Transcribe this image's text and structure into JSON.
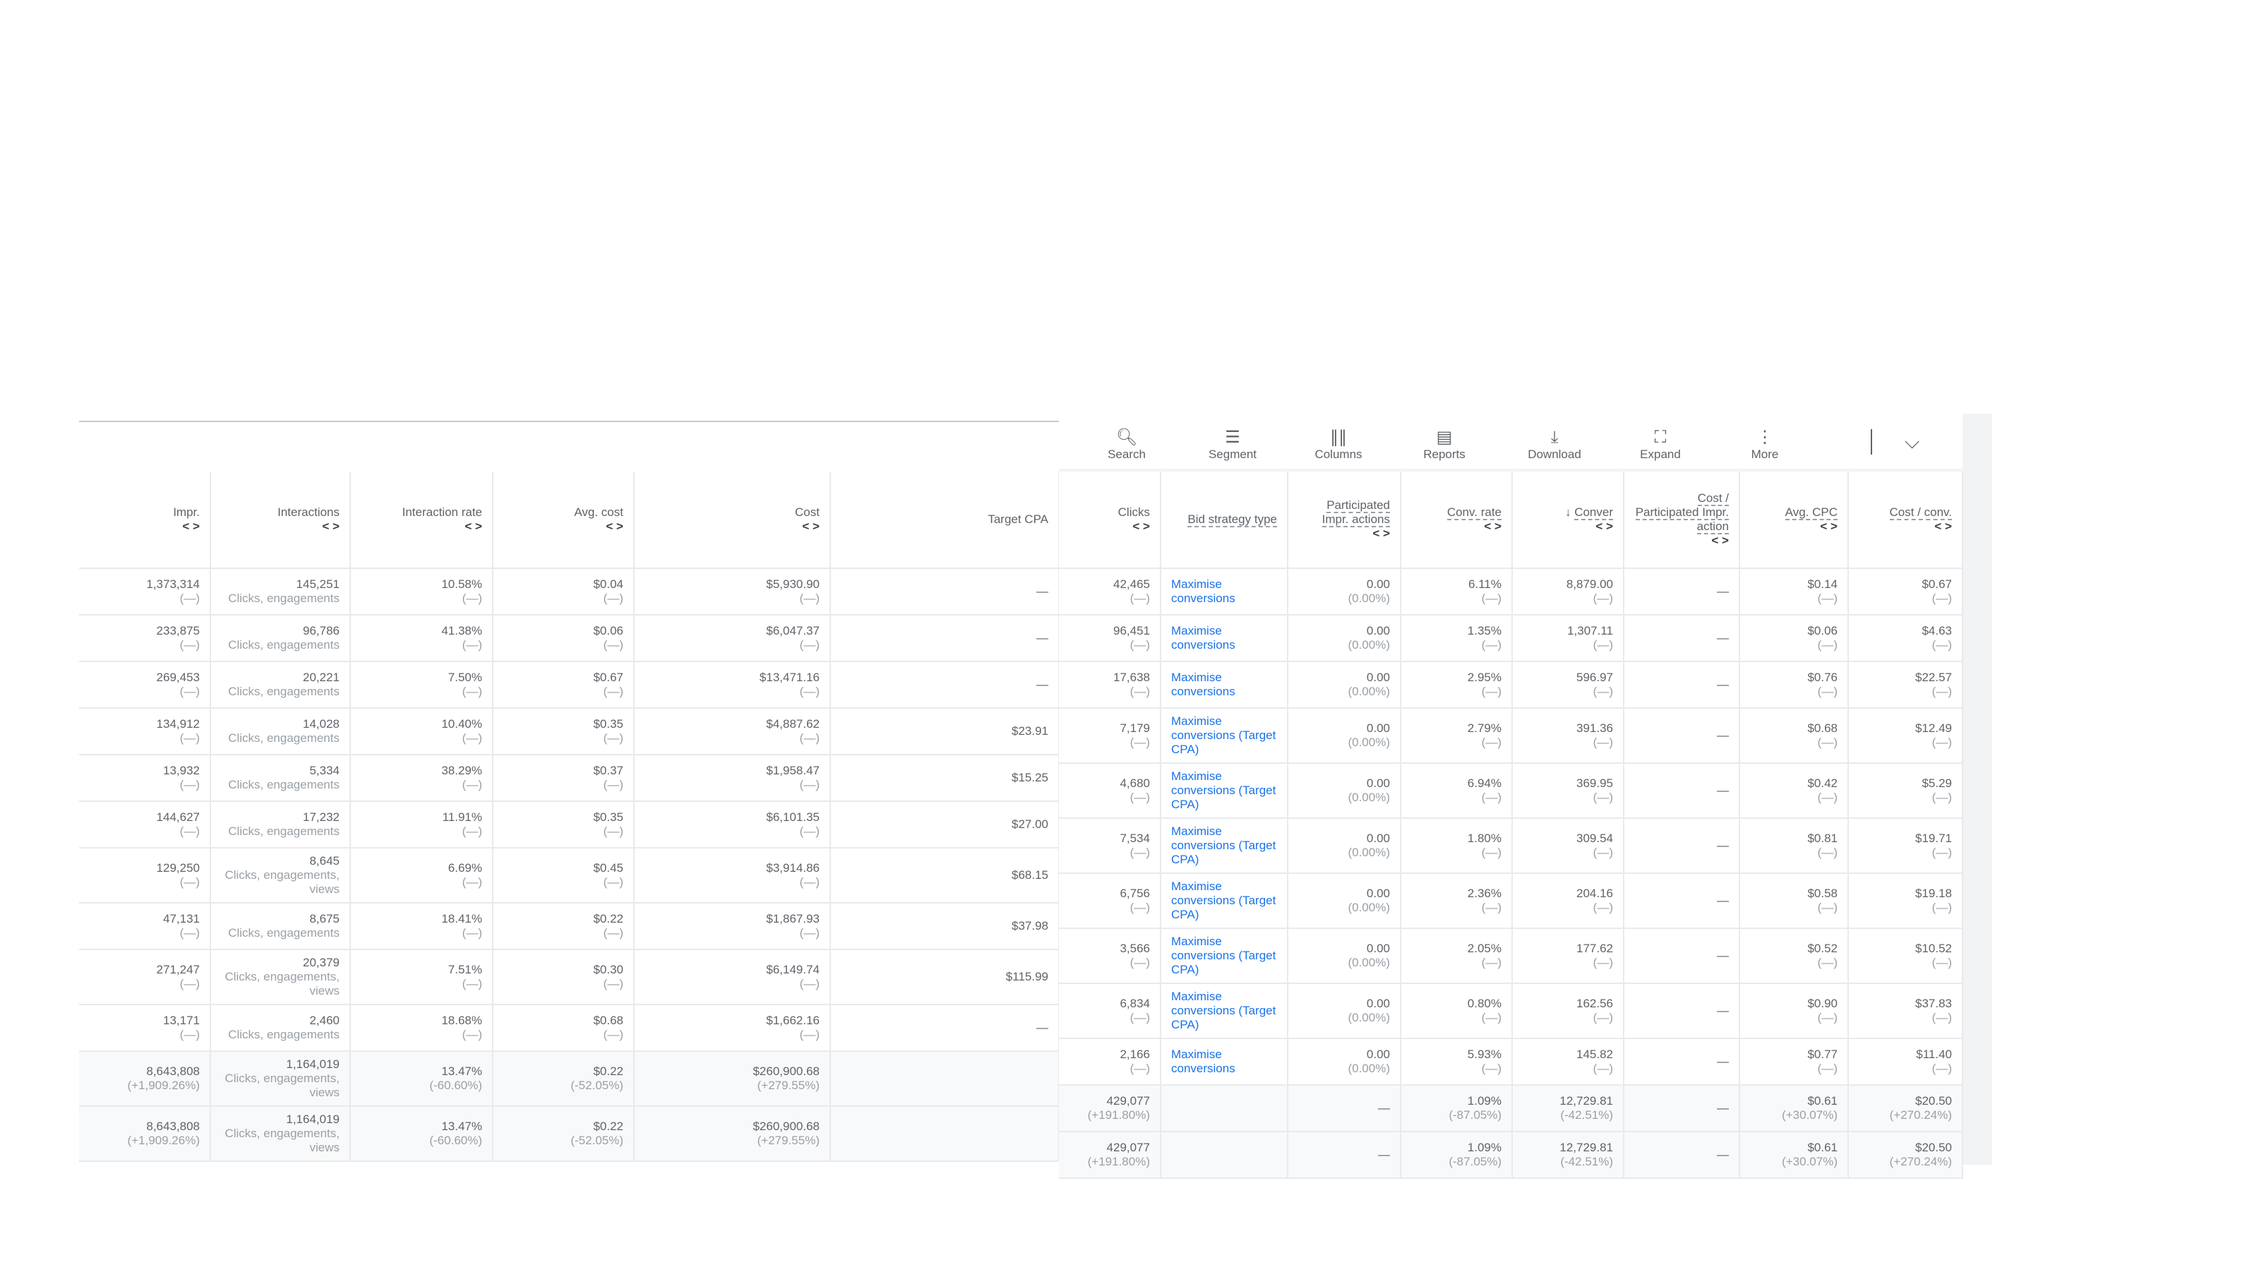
{
  "left_table": {
    "headers": [
      {
        "label": "Impr.",
        "arrows": "< >"
      },
      {
        "label": "Interactions",
        "arrows": "< >"
      },
      {
        "label": "Interaction rate",
        "arrows": "< >"
      },
      {
        "label": "Avg. cost",
        "arrows": "< >"
      },
      {
        "label": "Cost",
        "arrows": "< >"
      },
      {
        "label": "Target CPA",
        "arrows": ""
      }
    ],
    "rows": [
      {
        "impr": "1,373,314",
        "impr_sub": "(—)",
        "int": "145,251",
        "int_sub": "Clicks, engagements",
        "rate": "10.58%",
        "rate_sub": "(—)",
        "avg": "$0.04",
        "avg_sub": "(—)",
        "cost": "$5,930.90",
        "cost_sub": "(—)",
        "cpa": "—"
      },
      {
        "impr": "233,875",
        "impr_sub": "(—)",
        "int": "96,786",
        "int_sub": "Clicks, engagements",
        "rate": "41.38%",
        "rate_sub": "(—)",
        "avg": "$0.06",
        "avg_sub": "(—)",
        "cost": "$6,047.37",
        "cost_sub": "(—)",
        "cpa": "—"
      },
      {
        "impr": "269,453",
        "impr_sub": "(—)",
        "int": "20,221",
        "int_sub": "Clicks, engagements",
        "rate": "7.50%",
        "rate_sub": "(—)",
        "avg": "$0.67",
        "avg_sub": "(—)",
        "cost": "$13,471.16",
        "cost_sub": "(—)",
        "cpa": "—"
      },
      {
        "impr": "134,912",
        "impr_sub": "(—)",
        "int": "14,028",
        "int_sub": "Clicks, engagements",
        "rate": "10.40%",
        "rate_sub": "(—)",
        "avg": "$0.35",
        "avg_sub": "(—)",
        "cost": "$4,887.62",
        "cost_sub": "(—)",
        "cpa": "$23.91"
      },
      {
        "impr": "13,932",
        "impr_sub": "(—)",
        "int": "5,334",
        "int_sub": "Clicks, engagements",
        "rate": "38.29%",
        "rate_sub": "(—)",
        "avg": "$0.37",
        "avg_sub": "(—)",
        "cost": "$1,958.47",
        "cost_sub": "(—)",
        "cpa": "$15.25"
      },
      {
        "impr": "144,627",
        "impr_sub": "(—)",
        "int": "17,232",
        "int_sub": "Clicks, engagements",
        "rate": "11.91%",
        "rate_sub": "(—)",
        "avg": "$0.35",
        "avg_sub": "(—)",
        "cost": "$6,101.35",
        "cost_sub": "(—)",
        "cpa": "$27.00"
      },
      {
        "impr": "129,250",
        "impr_sub": "(—)",
        "int": "8,645",
        "int_sub": "Clicks, engagements, views",
        "rate": "6.69%",
        "rate_sub": "(—)",
        "avg": "$0.45",
        "avg_sub": "(—)",
        "cost": "$3,914.86",
        "cost_sub": "(—)",
        "cpa": "$68.15"
      },
      {
        "impr": "47,131",
        "impr_sub": "(—)",
        "int": "8,675",
        "int_sub": "Clicks, engagements",
        "rate": "18.41%",
        "rate_sub": "(—)",
        "avg": "$0.22",
        "avg_sub": "(—)",
        "cost": "$1,867.93",
        "cost_sub": "(—)",
        "cpa": "$37.98"
      },
      {
        "impr": "271,247",
        "impr_sub": "(—)",
        "int": "20,379",
        "int_sub": "Clicks, engagements, views",
        "rate": "7.51%",
        "rate_sub": "(—)",
        "avg": "$0.30",
        "avg_sub": "(—)",
        "cost": "$6,149.74",
        "cost_sub": "(—)",
        "cpa": "$115.99"
      },
      {
        "impr": "13,171",
        "impr_sub": "(—)",
        "int": "2,460",
        "int_sub": "Clicks, engagements",
        "rate": "18.68%",
        "rate_sub": "(—)",
        "avg": "$0.68",
        "avg_sub": "(—)",
        "cost": "$1,662.16",
        "cost_sub": "(—)",
        "cpa": "—"
      }
    ],
    "totals": [
      {
        "impr": "8,643,808",
        "impr_sub": "(+1,909.26%)",
        "int": "1,164,019",
        "int_sub": "Clicks, engagements, views",
        "rate": "13.47%",
        "rate_sub": "(-60.60%)",
        "avg": "$0.22",
        "avg_sub": "(-52.05%)",
        "cost": "$260,900.68",
        "cost_sub": "(+279.55%)",
        "cpa": ""
      },
      {
        "impr": "8,643,808",
        "impr_sub": "(+1,909.26%)",
        "int": "1,164,019",
        "int_sub": "Clicks, engagements, views",
        "rate": "13.47%",
        "rate_sub": "(-60.60%)",
        "avg": "$0.22",
        "avg_sub": "(-52.05%)",
        "cost": "$260,900.68",
        "cost_sub": "(+279.55%)",
        "cpa": ""
      }
    ]
  },
  "toolbar": {
    "search": "Search",
    "segment": "Segment",
    "columns": "Columns",
    "reports": "Reports",
    "download": "Download",
    "expand": "Expand",
    "more": "More"
  },
  "right_table": {
    "headers": [
      {
        "label": "Clicks",
        "arrows": "< >"
      },
      {
        "label": "Bid strategy type",
        "arrows": ""
      },
      {
        "label": "Participated Impr. actions",
        "arrows": "< >"
      },
      {
        "label": "Conv. rate",
        "arrows": "< >"
      },
      {
        "label": "Conver",
        "arrows": "< >",
        "sort": "↓"
      },
      {
        "label": "Cost / Participated Impr. action",
        "arrows": "< >"
      },
      {
        "label": "Avg. CPC",
        "arrows": "< >"
      },
      {
        "label": "Cost / conv.",
        "arrows": "< >"
      }
    ],
    "rows": [
      {
        "clicks": "42,465",
        "clicks_sub": "(—)",
        "bid": "Maximise conversions",
        "part": "0.00",
        "part_sub": "(0.00%)",
        "rate": "6.11%",
        "rate_sub": "(—)",
        "conv": "8,879.00",
        "conv_sub": "(—)",
        "cpp": "—",
        "cpc": "$0.14",
        "cpc_sub": "(—)",
        "cpconv": "$0.67",
        "cpconv_sub": "(—)"
      },
      {
        "clicks": "96,451",
        "clicks_sub": "(—)",
        "bid": "Maximise conversions",
        "part": "0.00",
        "part_sub": "(0.00%)",
        "rate": "1.35%",
        "rate_sub": "(—)",
        "conv": "1,307.11",
        "conv_sub": "(—)",
        "cpp": "—",
        "cpc": "$0.06",
        "cpc_sub": "(—)",
        "cpconv": "$4.63",
        "cpconv_sub": "(—)"
      },
      {
        "clicks": "17,638",
        "clicks_sub": "(—)",
        "bid": "Maximise conversions",
        "part": "0.00",
        "part_sub": "(0.00%)",
        "rate": "2.95%",
        "rate_sub": "(—)",
        "conv": "596.97",
        "conv_sub": "(—)",
        "cpp": "—",
        "cpc": "$0.76",
        "cpc_sub": "(—)",
        "cpconv": "$22.57",
        "cpconv_sub": "(—)"
      },
      {
        "clicks": "7,179",
        "clicks_sub": "(—)",
        "bid": "Maximise conversions (Target CPA)",
        "part": "0.00",
        "part_sub": "(0.00%)",
        "rate": "2.79%",
        "rate_sub": "(—)",
        "conv": "391.36",
        "conv_sub": "(—)",
        "cpp": "—",
        "cpc": "$0.68",
        "cpc_sub": "(—)",
        "cpconv": "$12.49",
        "cpconv_sub": "(—)"
      },
      {
        "clicks": "4,680",
        "clicks_sub": "(—)",
        "bid": "Maximise conversions (Target CPA)",
        "part": "0.00",
        "part_sub": "(0.00%)",
        "rate": "6.94%",
        "rate_sub": "(—)",
        "conv": "369.95",
        "conv_sub": "(—)",
        "cpp": "—",
        "cpc": "$0.42",
        "cpc_sub": "(—)",
        "cpconv": "$5.29",
        "cpconv_sub": "(—)"
      },
      {
        "clicks": "7,534",
        "clicks_sub": "(—)",
        "bid": "Maximise conversions (Target CPA)",
        "part": "0.00",
        "part_sub": "(0.00%)",
        "rate": "1.80%",
        "rate_sub": "(—)",
        "conv": "309.54",
        "conv_sub": "(—)",
        "cpp": "—",
        "cpc": "$0.81",
        "cpc_sub": "(—)",
        "cpconv": "$19.71",
        "cpconv_sub": "(—)"
      },
      {
        "clicks": "6,756",
        "clicks_sub": "(—)",
        "bid": "Maximise conversions (Target CPA)",
        "part": "0.00",
        "part_sub": "(0.00%)",
        "rate": "2.36%",
        "rate_sub": "(—)",
        "conv": "204.16",
        "conv_sub": "(—)",
        "cpp": "—",
        "cpc": "$0.58",
        "cpc_sub": "(—)",
        "cpconv": "$19.18",
        "cpconv_sub": "(—)"
      },
      {
        "clicks": "3,566",
        "clicks_sub": "(—)",
        "bid": "Maximise conversions (Target CPA)",
        "part": "0.00",
        "part_sub": "(0.00%)",
        "rate": "2.05%",
        "rate_sub": "(—)",
        "conv": "177.62",
        "conv_sub": "(—)",
        "cpp": "—",
        "cpc": "$0.52",
        "cpc_sub": "(—)",
        "cpconv": "$10.52",
        "cpconv_sub": "(—)"
      },
      {
        "clicks": "6,834",
        "clicks_sub": "(—)",
        "bid": "Maximise conversions (Target CPA)",
        "part": "0.00",
        "part_sub": "(0.00%)",
        "rate": "0.80%",
        "rate_sub": "(—)",
        "conv": "162.56",
        "conv_sub": "(—)",
        "cpp": "—",
        "cpc": "$0.90",
        "cpc_sub": "(—)",
        "cpconv": "$37.83",
        "cpconv_sub": "(—)"
      },
      {
        "clicks": "2,166",
        "clicks_sub": "(—)",
        "bid": "Maximise conversions",
        "part": "0.00",
        "part_sub": "(0.00%)",
        "rate": "5.93%",
        "rate_sub": "(—)",
        "conv": "145.82",
        "conv_sub": "(—)",
        "cpp": "—",
        "cpc": "$0.77",
        "cpc_sub": "(—)",
        "cpconv": "$11.40",
        "cpconv_sub": "(—)"
      }
    ],
    "totals": [
      {
        "clicks": "429,077",
        "clicks_sub": "(+191.80%)",
        "bid": "",
        "part": "—",
        "part_sub": "",
        "rate": "1.09%",
        "rate_sub": "(-87.05%)",
        "conv": "12,729.81",
        "conv_sub": "(-42.51%)",
        "cpp": "—",
        "cpc": "$0.61",
        "cpc_sub": "(+30.07%)",
        "cpconv": "$20.50",
        "cpconv_sub": "(+270.24%)"
      },
      {
        "clicks": "429,077",
        "clicks_sub": "(+191.80%)",
        "bid": "",
        "part": "—",
        "part_sub": "",
        "rate": "1.09%",
        "rate_sub": "(-87.05%)",
        "conv": "12,729.81",
        "conv_sub": "(-42.51%)",
        "cpp": "—",
        "cpc": "$0.61",
        "cpc_sub": "(+30.07%)",
        "cpconv": "$20.50",
        "cpconv_sub": "(+270.24%)"
      }
    ]
  }
}
